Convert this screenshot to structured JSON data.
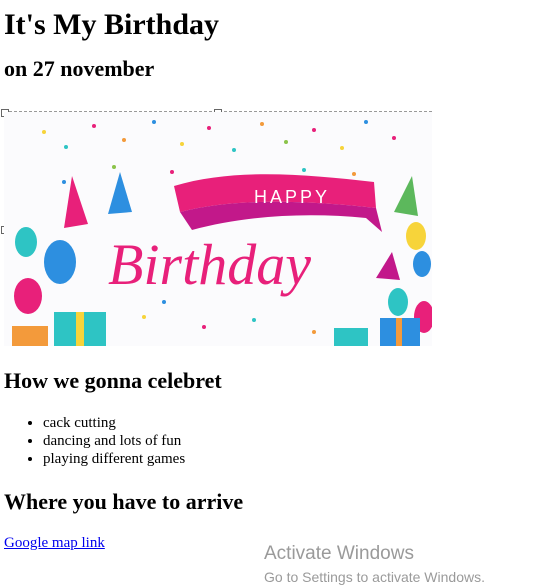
{
  "page": {
    "title": "It's My Birthday",
    "subtitle": "on 27 november"
  },
  "banner": {
    "icon": "birthday-banner-image",
    "happy_text": "HAPPY",
    "birthday_text": "Birthday",
    "colors": {
      "pink": "#e8207a",
      "magenta": "#c2188a",
      "orange": "#f39a3b",
      "teal": "#2ec4c4",
      "blue": "#2d8fe0",
      "yellow": "#f7d43a"
    }
  },
  "celebrate": {
    "heading": "How we gonna celebret",
    "items": [
      "cack cutting",
      "dancing and lots of fun",
      "playing different games"
    ]
  },
  "arrive": {
    "heading": "Where you have to arrive",
    "link_text": "Google map link"
  },
  "watermark": {
    "line1": "Activate Windows",
    "line2": "Go to Settings to activate Windows."
  }
}
